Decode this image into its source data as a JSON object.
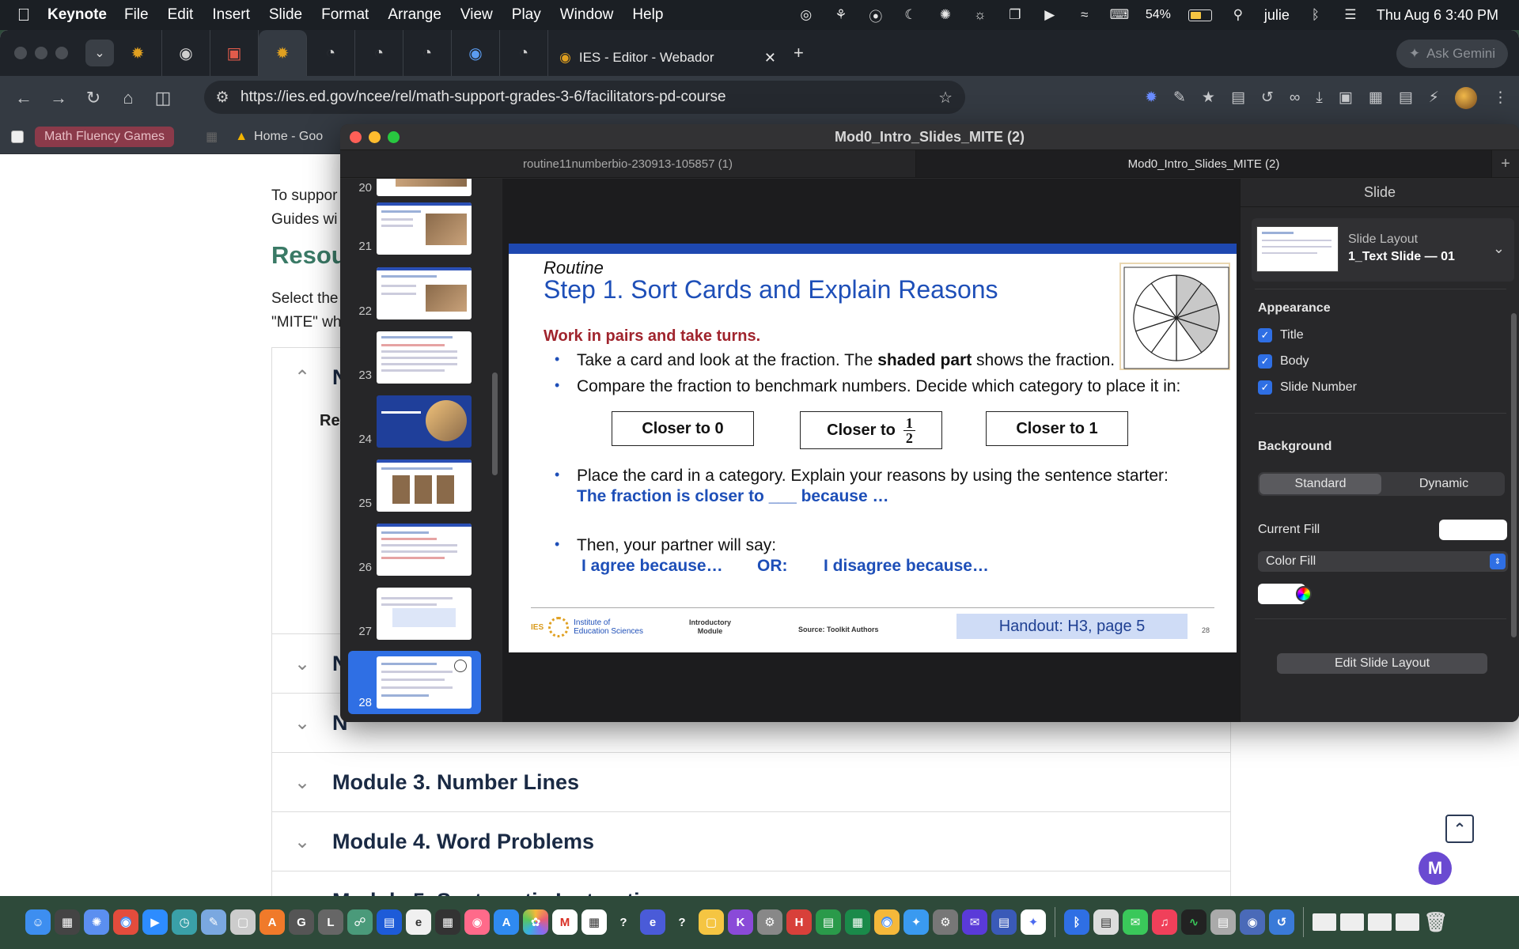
{
  "menubar": {
    "app_name": "Keynote",
    "items": [
      "File",
      "Edit",
      "Insert",
      "Slide",
      "Format",
      "Arrange",
      "View",
      "Play",
      "Window",
      "Help"
    ],
    "battery_percent": "54%",
    "battery_level": 0.54,
    "user": "julie",
    "datetime": "Thu Aug 6  3:40 PM"
  },
  "browser": {
    "active_tab_title": "IES - Editor - Webador",
    "ask_gemini": "Ask Gemini",
    "url": "https://ies.ed.gov/ncee/rel/math-support-grades-3-6/facilitators-pd-course",
    "bookmarks": {
      "pill": "Math Fluency Games",
      "home": "Home - Goo"
    }
  },
  "webpage": {
    "intro_line1": "To suppor",
    "intro_line2": "Guides wi",
    "heading": "Resou",
    "select_line1": "Select the",
    "select_line2": "\"MITE\" wh",
    "open_row_partial": "N",
    "row_sub": "Re",
    "row_n1": "N",
    "row_n2": "N",
    "modules": [
      "Module 3. Number Lines",
      "Module 4. Word Problems",
      "Module 5. Systematic Instruction"
    ],
    "m_button": "M"
  },
  "keynote": {
    "window_title": "Mod0_Intro_Slides_MITE (2)",
    "tabs": [
      "routine11numberbio-230913-105857 (1)",
      "Mod0_Intro_Slides_MITE (2)"
    ],
    "slide_numbers": [
      "20",
      "21",
      "22",
      "23",
      "24",
      "25",
      "26",
      "27",
      "28"
    ],
    "slide": {
      "routine": "Routine",
      "title": "Step 1. Sort Cards and Explain Reasons",
      "work": "Work in pairs and take turns.",
      "b1_pre": "Take a card and look at the fraction. The ",
      "b1_bold": "shaded part",
      "b1_post": " shows the fraction.",
      "b2": "Compare the fraction to benchmark numbers. Decide which category to place it in:",
      "box1": "Closer to 0",
      "box2": "Closer to",
      "box2_num": "1",
      "box2_den": "2",
      "box3": "Closer to 1",
      "b3": "Place the card in a category. Explain your reasons by using the sentence starter:",
      "b3_blue": "The fraction is closer to ___ because …",
      "b4": "Then, your partner will say:",
      "agree": "I agree because…",
      "or": "OR:",
      "disagree": "I disagree because…",
      "ies_short": "IES",
      "org1": "Institute of",
      "org2": "Education Sciences",
      "intro1": "Introductory",
      "intro2": "Module",
      "source": "Source: Toolkit Authors",
      "handout": "Handout: H3, page 5",
      "num": "28",
      "pie_segments": 10,
      "pie_shaded": 4
    },
    "inspector": {
      "header": "Slide",
      "layout_label": "Slide Layout",
      "layout_name": "1_Text Slide — 01",
      "appearance": "Appearance",
      "check_title": "Title",
      "check_body": "Body",
      "check_slide_number": "Slide Number",
      "background": "Background",
      "seg_standard": "Standard",
      "seg_dynamic": "Dynamic",
      "current_fill": "Current Fill",
      "fill_type": "Color Fill",
      "edit_layout": "Edit Slide Layout"
    }
  },
  "colors": {
    "accent_blue": "#2f6fe4",
    "slide_title_blue": "#1e4fb8",
    "slide_red": "#a0242d",
    "ies_green": "#3a7a66"
  }
}
